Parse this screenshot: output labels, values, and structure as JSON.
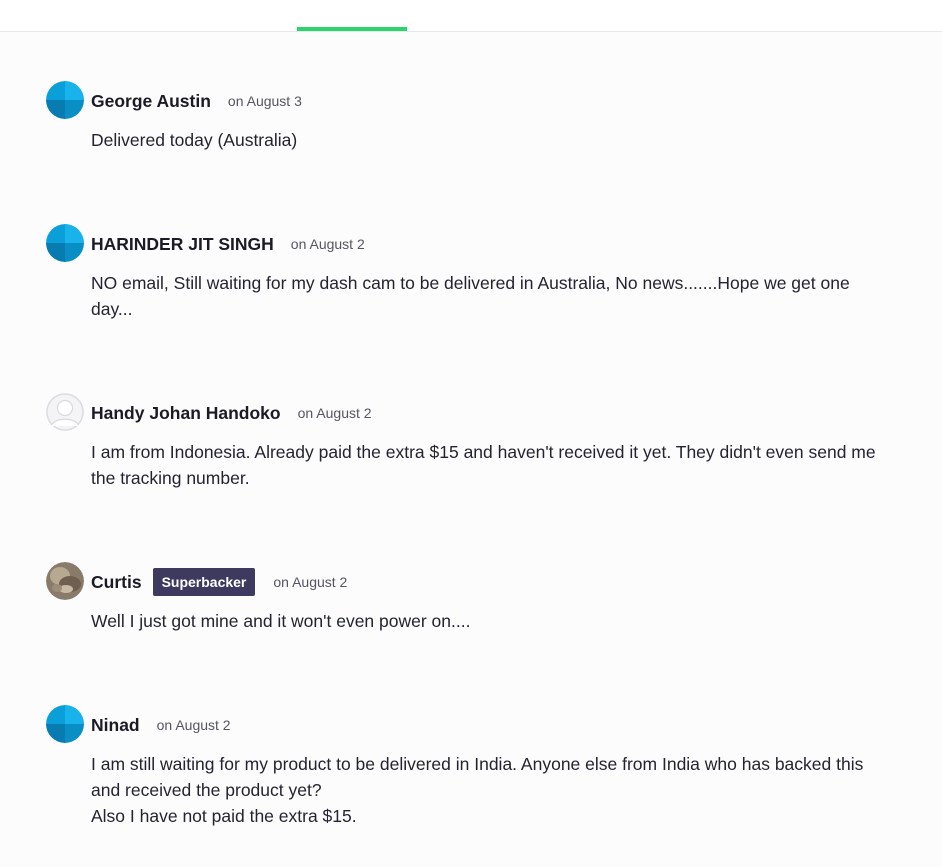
{
  "comments": [
    {
      "author": "George Austin",
      "date": "on August 3",
      "avatar": "default-blue-avatar",
      "lines": [
        "Delivered today (Australia)"
      ]
    },
    {
      "author": "HARINDER JIT SINGH",
      "date": "on August 2",
      "avatar": "default-blue-avatar",
      "lines": [
        "NO email, Still waiting for my dash cam to be delivered in Australia, No news.......Hope we get one day..."
      ]
    },
    {
      "author": "Handy Johan Handoko",
      "date": "on August 2",
      "avatar": "placeholder-user-avatar",
      "lines": [
        "I am from Indonesia. Already paid the extra $15 and haven't received it yet. They didn't even send me the tracking number."
      ]
    },
    {
      "author": "Curtis",
      "badge": "Superbacker",
      "date": "on August 2",
      "avatar": "photo-avatar",
      "lines": [
        "Well I just got mine and it won't even power on...."
      ]
    },
    {
      "author": "Ninad",
      "date": "on August 2",
      "avatar": "default-blue-avatar",
      "lines": [
        "I am still waiting for my product to be delivered in India. Anyone else from India who has backed this and received the product yet?",
        "Also I have not paid the extra $15."
      ]
    }
  ],
  "colors": {
    "tab_indicator": "#2bd46d",
    "badge_bg": "#3e3a5f",
    "avatar_blue": "#0a9fd8"
  }
}
